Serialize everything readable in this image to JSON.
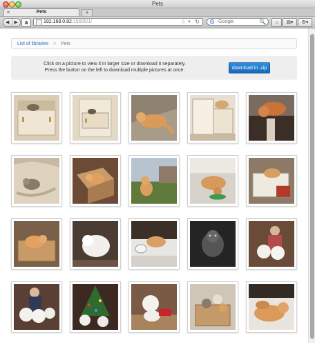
{
  "window": {
    "title": "Pets"
  },
  "tab": {
    "title": "Pets",
    "new_tab": "+"
  },
  "toolbar": {
    "url_host": "192.168.0.82",
    "url_path": ":15555/1/",
    "search_placeholder": "Google",
    "amazon_label": "a"
  },
  "breadcrumb": {
    "root": "List of libraries",
    "separator": ">",
    "current": "Pets"
  },
  "info": {
    "line1": "Click on a picture to view it in larger size or download it separately.",
    "line2": "Press the button on the left to download multiple pictures at once.",
    "button": "download in .zip"
  },
  "thumbnails": [
    {
      "id": "1",
      "scene": "drawer-cat",
      "video": false
    },
    {
      "id": "2",
      "scene": "drawer-open",
      "video": false
    },
    {
      "id": "3",
      "scene": "orange-cat-floor",
      "video": false
    },
    {
      "id": "4",
      "scene": "cabinet-cat",
      "video": false
    },
    {
      "id": "5",
      "scene": "cat-stand",
      "video": true
    },
    {
      "id": "6",
      "scene": "cat-blanket",
      "video": false
    },
    {
      "id": "7",
      "scene": "cat-box",
      "video": false
    },
    {
      "id": "8",
      "scene": "cat-yard",
      "video": false
    },
    {
      "id": "9",
      "scene": "cat-eating",
      "video": false
    },
    {
      "id": "10",
      "scene": "cat-crate",
      "video": false
    },
    {
      "id": "11",
      "scene": "cat-box-2",
      "video": false
    },
    {
      "id": "12",
      "scene": "white-dog",
      "video": true
    },
    {
      "id": "13",
      "scene": "cat-bowl",
      "video": false
    },
    {
      "id": "14",
      "scene": "dark-cat",
      "video": false
    },
    {
      "id": "15",
      "scene": "person-dogs",
      "video": false
    },
    {
      "id": "16",
      "scene": "person-dogs-2",
      "video": false
    },
    {
      "id": "17",
      "scene": "christmas-dogs",
      "video": false
    },
    {
      "id": "18",
      "scene": "dog-red-toy",
      "video": false
    },
    {
      "id": "19",
      "scene": "kittens-box",
      "video": false
    },
    {
      "id": "20",
      "scene": "cats-sofa",
      "video": false
    }
  ]
}
